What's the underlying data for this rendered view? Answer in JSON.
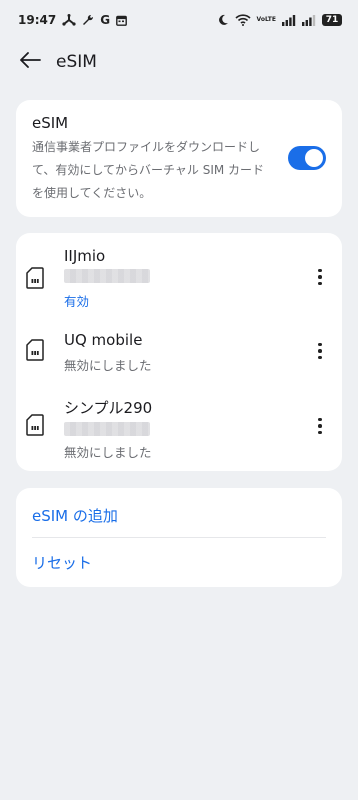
{
  "status_bar": {
    "time": "19:47",
    "carrier_letter": "G",
    "volte_label_top": "Vo",
    "volte_label_mid": "LTE",
    "battery": "71",
    "icons": [
      "usb-debug-icon",
      "wrench-icon",
      "google-icon",
      "calendar-icon",
      "moon-icon",
      "wifi-icon",
      "volte-icon",
      "signal-icon",
      "signal-icon",
      "battery-icon"
    ]
  },
  "header": {
    "title": "eSIM",
    "back_icon": "arrow-left-icon"
  },
  "esim_card": {
    "title": "eSIM",
    "description": "通信事業者プロファイルをダウンロードして、有効にしてからバーチャル SIM カードを使用してください。",
    "toggle_on": true,
    "toggle_color": "#1a6ee8"
  },
  "sims": [
    {
      "name": "IIJmio",
      "status": "有効",
      "active": true
    },
    {
      "name": "UQ mobile",
      "status": "無効にしました",
      "active": false
    },
    {
      "name": "シンプル290",
      "status": "無効にしました",
      "active": false
    }
  ],
  "actions": {
    "add_esim": "eSIM の追加",
    "reset": "リセット"
  },
  "colors": {
    "accent": "#1a6ee8",
    "background": "#eef0f3",
    "card": "#ffffff",
    "secondary_text": "#6b6d72"
  }
}
